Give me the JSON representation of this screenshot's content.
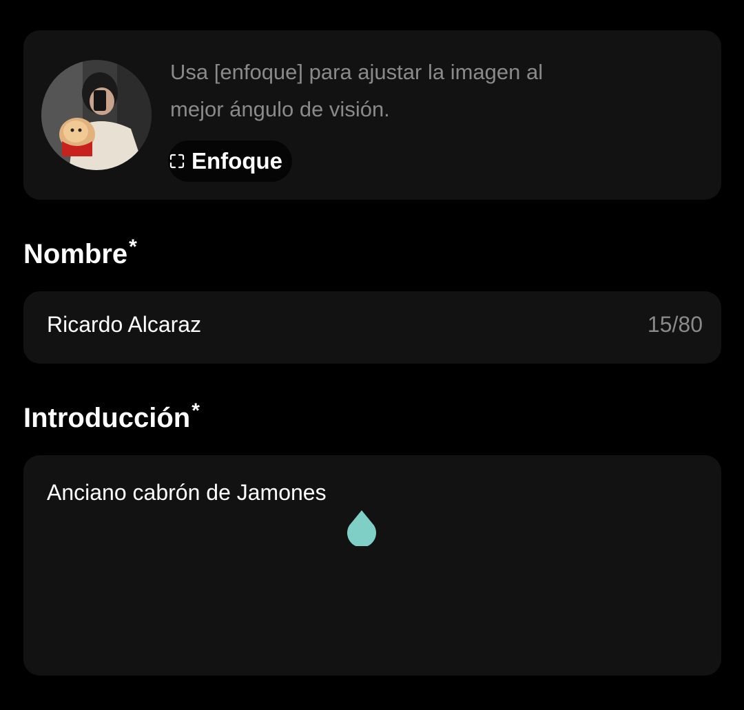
{
  "photo": {
    "hint": "Usa [enfoque] para ajustar la imagen al mejor ángulo de visión.",
    "focus_button_label": "Enfoque",
    "focus_icon": "focus-frame-icon"
  },
  "name": {
    "label": "Nombre",
    "required_mark": "*",
    "value": "Ricardo Alcaraz",
    "counter": "15/80"
  },
  "intro": {
    "label": "Introducción",
    "required_mark": "*",
    "value": "Anciano cabrón de Jamones"
  },
  "colors": {
    "background": "#000000",
    "card": "#121212",
    "muted_text": "#8a8a8a",
    "cursor_handle": "#7fcfc6"
  }
}
